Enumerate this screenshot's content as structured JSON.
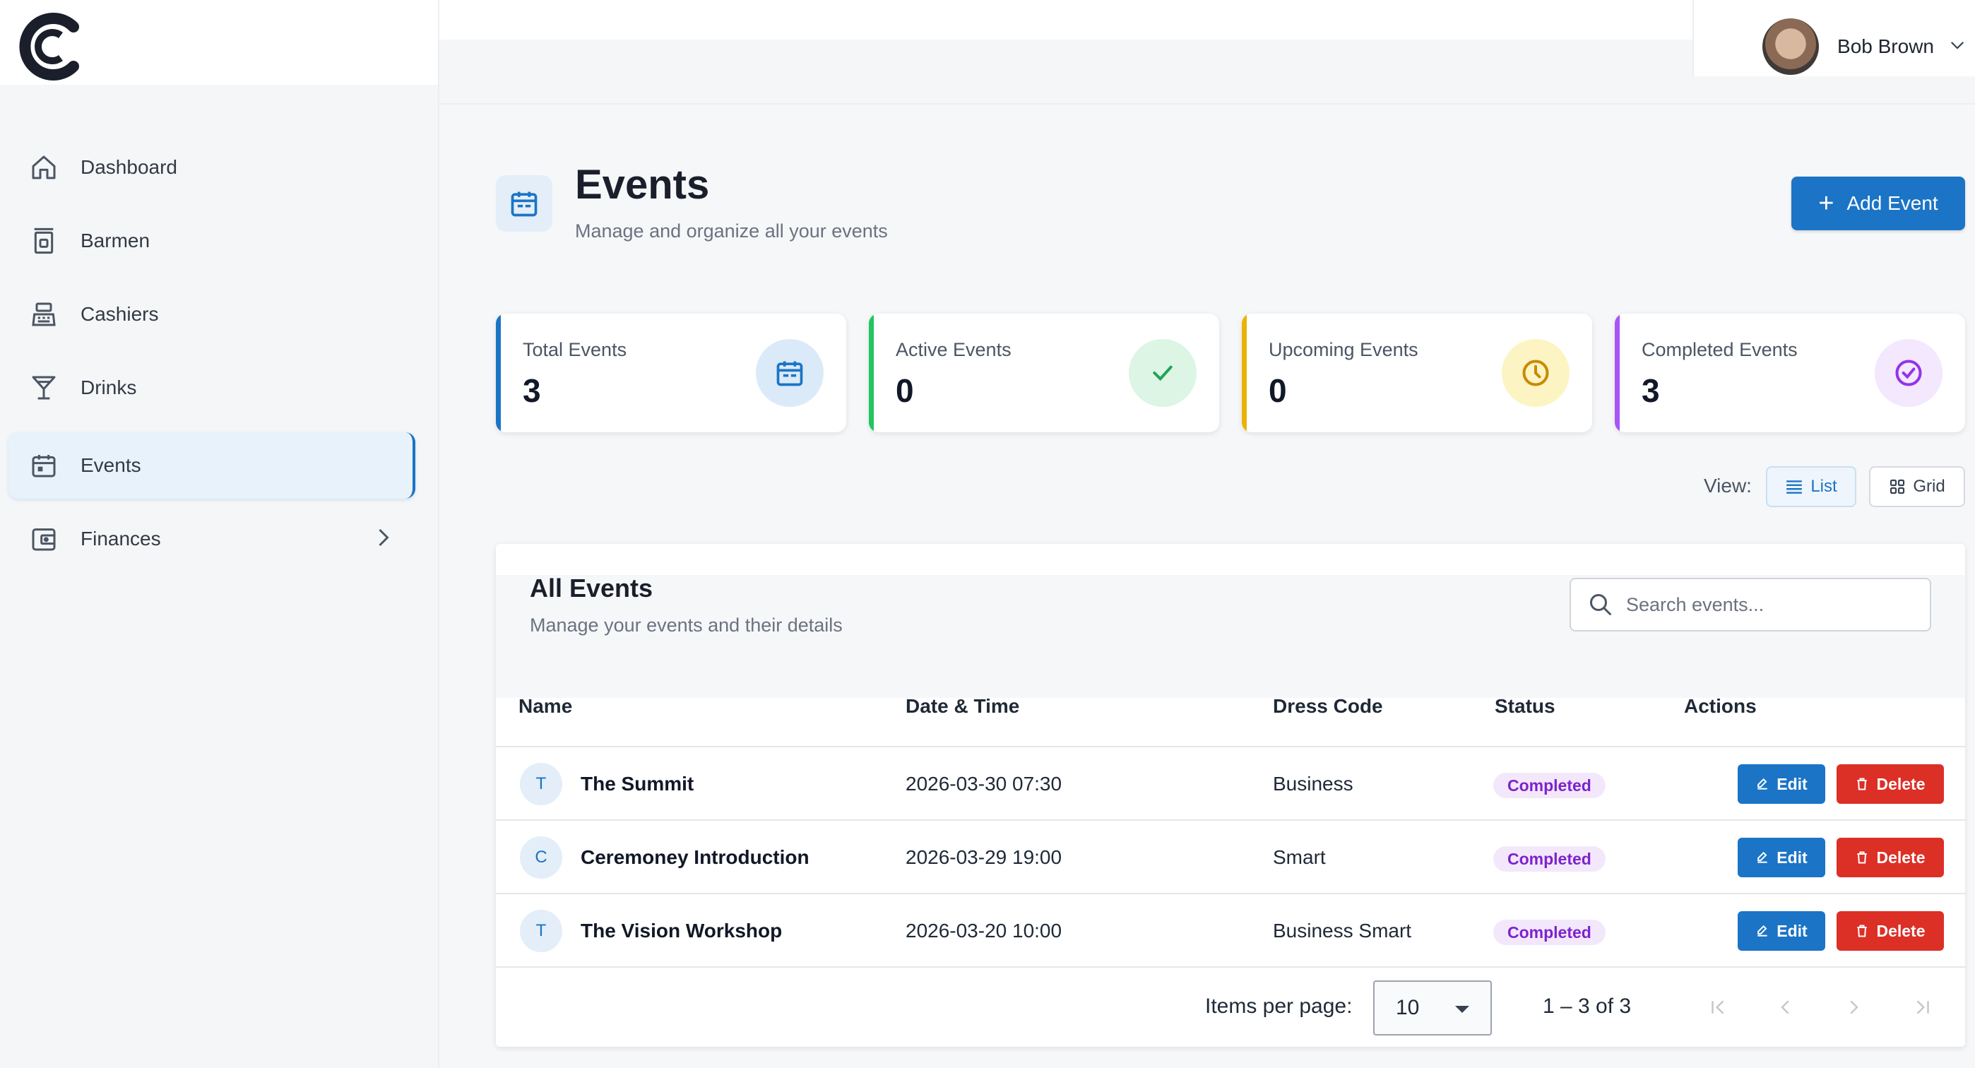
{
  "user": {
    "name": "Bob Brown"
  },
  "sidebar": {
    "items": [
      {
        "label": "Dashboard",
        "icon": "home-icon"
      },
      {
        "label": "Barmen",
        "icon": "barman-icon"
      },
      {
        "label": "Cashiers",
        "icon": "cash-register-icon"
      },
      {
        "label": "Drinks",
        "icon": "cocktail-glass-icon"
      },
      {
        "label": "Events",
        "icon": "calendar-icon",
        "active": true
      },
      {
        "label": "Finances",
        "icon": "wallet-icon",
        "expandable": true
      }
    ]
  },
  "header": {
    "title": "Events",
    "subtitle": "Manage and organize all your events",
    "add_label": "Add Event"
  },
  "stats": [
    {
      "label": "Total Events",
      "value": "3",
      "color": "#1b74c5",
      "icon": "calendar-icon"
    },
    {
      "label": "Active Events",
      "value": "0",
      "color": "#22c55e",
      "icon": "check-icon"
    },
    {
      "label": "Upcoming Events",
      "value": "0",
      "color": "#eab308",
      "icon": "clock-icon"
    },
    {
      "label": "Completed Events",
      "value": "3",
      "color": "#a855f7",
      "icon": "check-circle-icon"
    }
  ],
  "view": {
    "label": "View:",
    "list_label": "List",
    "grid_label": "Grid",
    "selected": "List"
  },
  "table": {
    "title": "All Events",
    "subtitle": "Manage your events and their details",
    "search_placeholder": "Search events...",
    "columns": [
      "Name",
      "Date & Time",
      "Dress Code",
      "Status",
      "Actions"
    ],
    "edit_label": "Edit",
    "delete_label": "Delete",
    "rows": [
      {
        "initial": "T",
        "name": "The Summit",
        "datetime": "2026-03-30 07:30",
        "dress_code": "Business",
        "status": "Completed"
      },
      {
        "initial": "C",
        "name": "Ceremoney Introduction",
        "datetime": "2026-03-29 19:00",
        "dress_code": "Smart",
        "status": "Completed"
      },
      {
        "initial": "T",
        "name": "The Vision Workshop",
        "datetime": "2026-03-20 10:00",
        "dress_code": "Business Smart",
        "status": "Completed"
      }
    ]
  },
  "pagination": {
    "items_per_page_label": "Items per page:",
    "items_per_page": "10",
    "range": "1 – 3 of 3"
  },
  "colors": {
    "accent": "#1b74c5",
    "danger": "#dc2f26",
    "status_completed": "#7e22ce"
  }
}
